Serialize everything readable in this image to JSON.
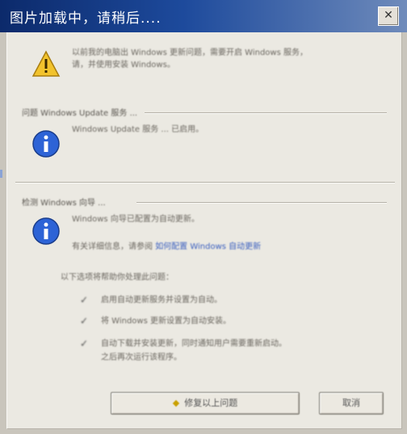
{
  "window": {
    "title": "图片加载中，请稍后....",
    "close_glyph": "✕"
  },
  "warning": {
    "icon": "warning-icon",
    "line1": "以前我的电脑出 Windows 更新问题，需要开启 Windows 服务，",
    "line2": "请，并使用安装 Windows。"
  },
  "section1": {
    "header": "问题 Windows Update 服务 ...",
    "icon": "info-icon",
    "text": "Windows Update 服务 ... 已启用。"
  },
  "section2": {
    "header": "检测 Windows 向导 ...",
    "icon": "info-icon",
    "line1": "Windows 向导已配置为自动更新。",
    "line2_prefix": "有关详细信息，请参阅",
    "link": "如何配置 Windows 自动更新",
    "sub_header": "以下选项将帮助你处理此问题：",
    "options": [
      {
        "label": "启用自动更新服务并设置为自动。",
        "checked": true
      },
      {
        "label": "将 Windows 更新设置为自动安装。",
        "checked": true
      },
      {
        "label": "自动下载并安装更新，同时通知用户需要重新启动。",
        "checked": true
      }
    ],
    "options_extra": "之后再次运行该程序。"
  },
  "buttons": {
    "primary": "修复以上问题",
    "secondary": "取消"
  }
}
